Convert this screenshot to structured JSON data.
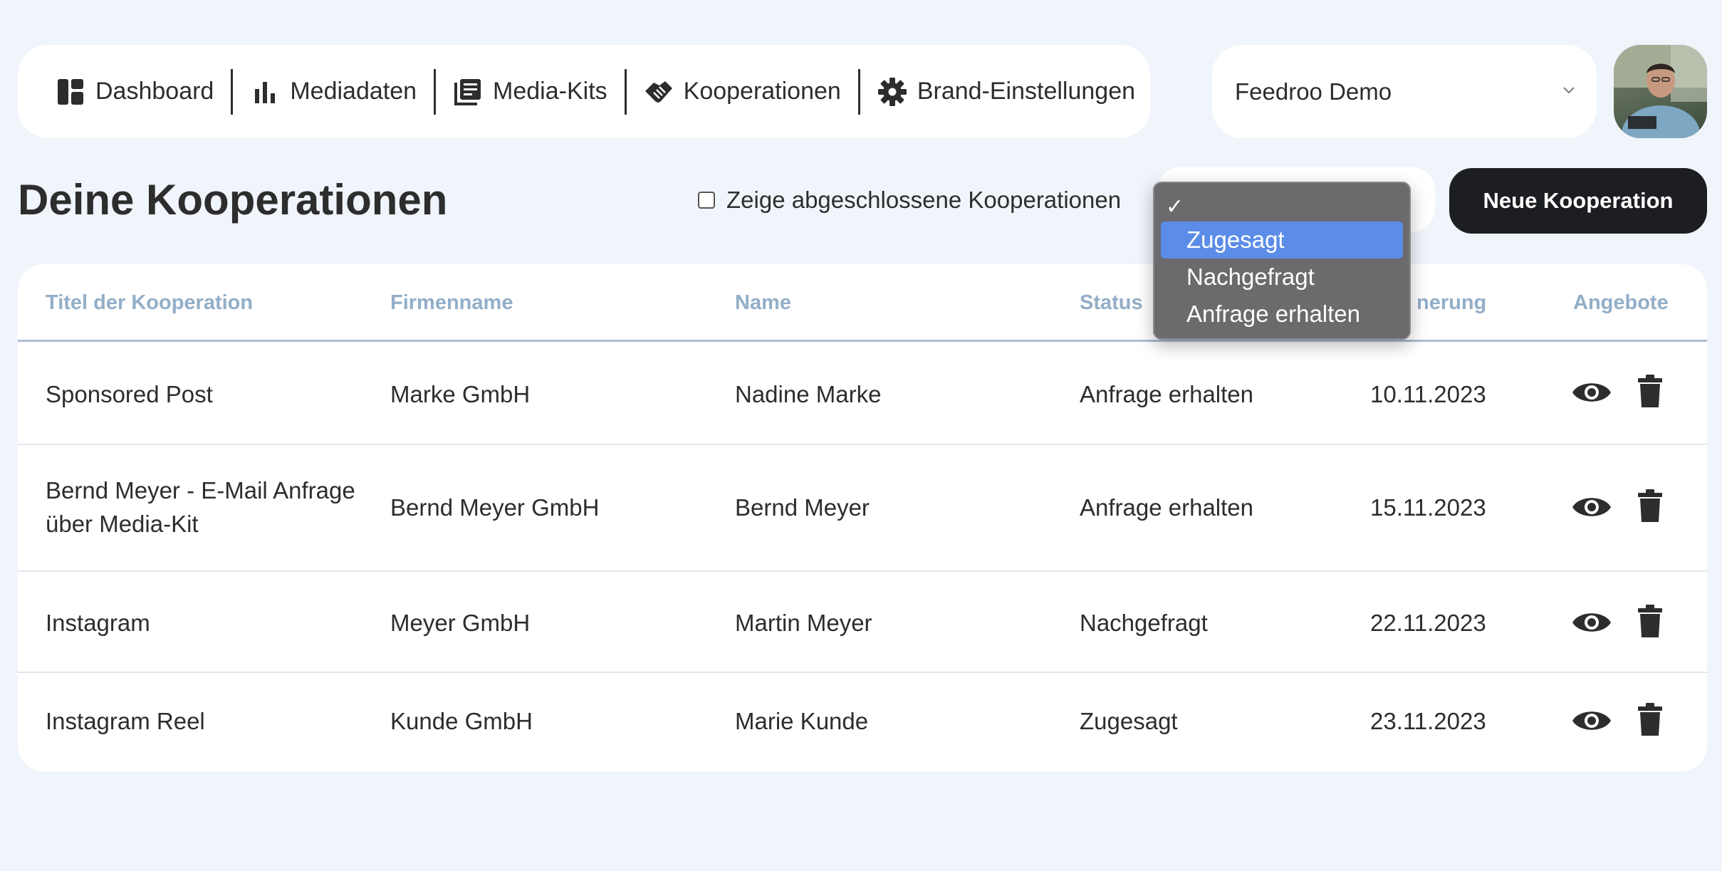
{
  "nav": {
    "items": [
      {
        "label": "Dashboard",
        "icon": "dashboard-icon"
      },
      {
        "label": "Mediadaten",
        "icon": "bar-chart-icon"
      },
      {
        "label": "Media-Kits",
        "icon": "media-kit-icon"
      },
      {
        "label": "Kooperationen",
        "icon": "handshake-icon"
      },
      {
        "label": "Brand-Einstellungen",
        "icon": "gear-icon"
      }
    ]
  },
  "brand_select": {
    "value": "Feedroo Demo"
  },
  "page": {
    "title": "Deine Kooperationen",
    "show_closed_label": "Zeige abgeschlossene Kooperationen",
    "new_button": "Neue Kooperation"
  },
  "status_dropdown": {
    "check": "✓",
    "options": [
      "Zugesagt",
      "Nachgefragt",
      "Anfrage erhalten"
    ],
    "highlighted": "Zugesagt"
  },
  "table": {
    "headers": [
      "Titel der Kooperation",
      "Firmenname",
      "Name",
      "Status",
      "nerung",
      "Angebote"
    ],
    "rows": [
      {
        "title": "Sponsored Post",
        "company": "Marke GmbH",
        "name": "Nadine Marke",
        "status": "Anfrage erhalten",
        "date": "10.11.2023"
      },
      {
        "title": "Bernd Meyer - E-Mail Anfrage über Media-Kit",
        "company": "Bernd Meyer GmbH",
        "name": "Bernd Meyer",
        "status": "Anfrage erhalten",
        "date": "15.11.2023"
      },
      {
        "title": "Instagram",
        "company": "Meyer GmbH",
        "name": "Martin Meyer",
        "status": "Nachgefragt",
        "date": "22.11.2023"
      },
      {
        "title": "Instagram Reel",
        "company": "Kunde GmbH",
        "name": "Marie Kunde",
        "status": "Zugesagt",
        "date": "23.11.2023"
      }
    ]
  },
  "colors": {
    "background": "#f0f4fb",
    "header_text": "#93aec8",
    "primary_button": "#1c1e22",
    "dropdown_highlight": "#5b8de8"
  }
}
